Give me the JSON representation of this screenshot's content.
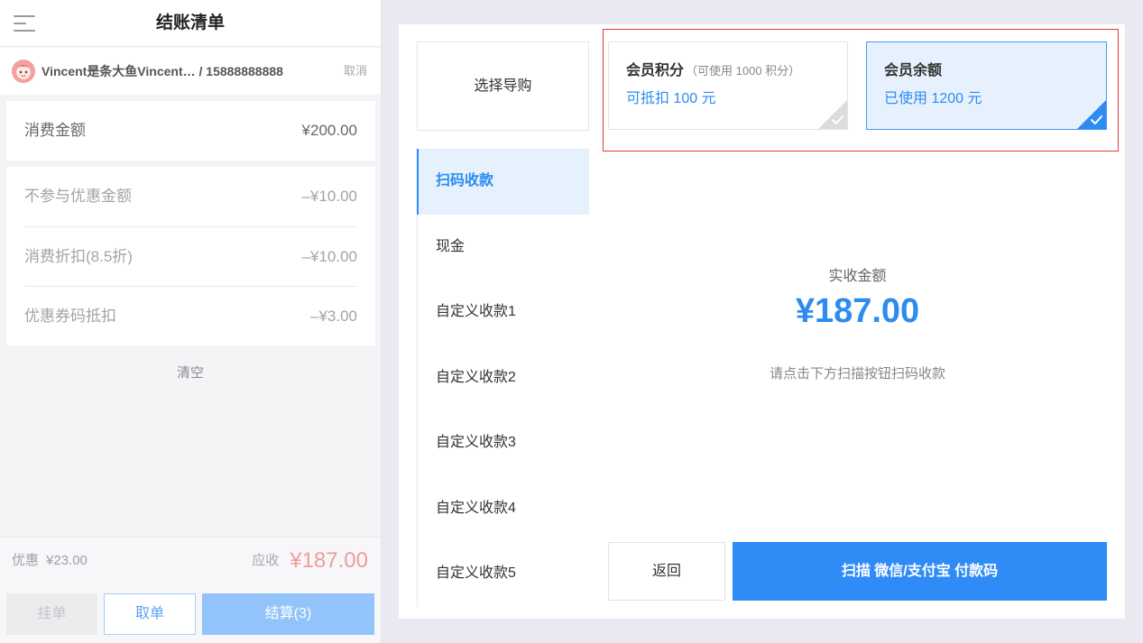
{
  "colors": {
    "primary": "#2d8cf0",
    "receivable_red": "#f29a9a",
    "highlight_frame": "#e23b3b",
    "page_background": "#e9e9f1"
  },
  "header": {
    "title": "结账清单",
    "menu_icon": "menu-icon"
  },
  "member": {
    "avatar_icon": "avatar",
    "info": "Vincent是条大鱼Vincent… / 15888888888",
    "cancel_label": "取消"
  },
  "bill": {
    "total": {
      "label": "消费金额",
      "value": "¥200.00"
    },
    "deductions": [
      {
        "label": "不参与优惠金额",
        "value": "–¥10.00"
      },
      {
        "label": "消费折扣(8.5折)",
        "value": "–¥10.00"
      },
      {
        "label": "优惠券码抵扣",
        "value": "–¥3.00"
      }
    ],
    "clear_label": "清空"
  },
  "footer": {
    "discount_label": "优惠",
    "discount_value": "¥23.00",
    "receivable_label": "应收",
    "receivable_value": "¥187.00"
  },
  "actions": {
    "hold_label": "挂单",
    "retrieve_label": "取单",
    "checkout_label": "结算(3)"
  },
  "payment": {
    "guide_label": "选择导购",
    "methods": [
      {
        "label": "扫码收款",
        "selected": true
      },
      {
        "label": "现金",
        "selected": false
      },
      {
        "label": "自定义收款1",
        "selected": false
      },
      {
        "label": "自定义收款2",
        "selected": false
      },
      {
        "label": "自定义收款3",
        "selected": false
      },
      {
        "label": "自定义收款4",
        "selected": false
      },
      {
        "label": "自定义收款5",
        "selected": false
      }
    ],
    "member_options": [
      {
        "title": "会员积分",
        "note": "（可使用 1000 积分）",
        "detail": "可抵扣 100 元",
        "selected": false,
        "icon": "check-icon"
      },
      {
        "title": "会员余额",
        "detail": "已使用 1200 元",
        "selected": true,
        "icon": "check-icon"
      }
    ],
    "amount_label": "实收金额",
    "amount_value": "¥187.00",
    "hint": "请点击下方扫描按钮扫码收款",
    "back_label": "返回",
    "scan_label": "扫描 微信/支付宝 付款码"
  }
}
